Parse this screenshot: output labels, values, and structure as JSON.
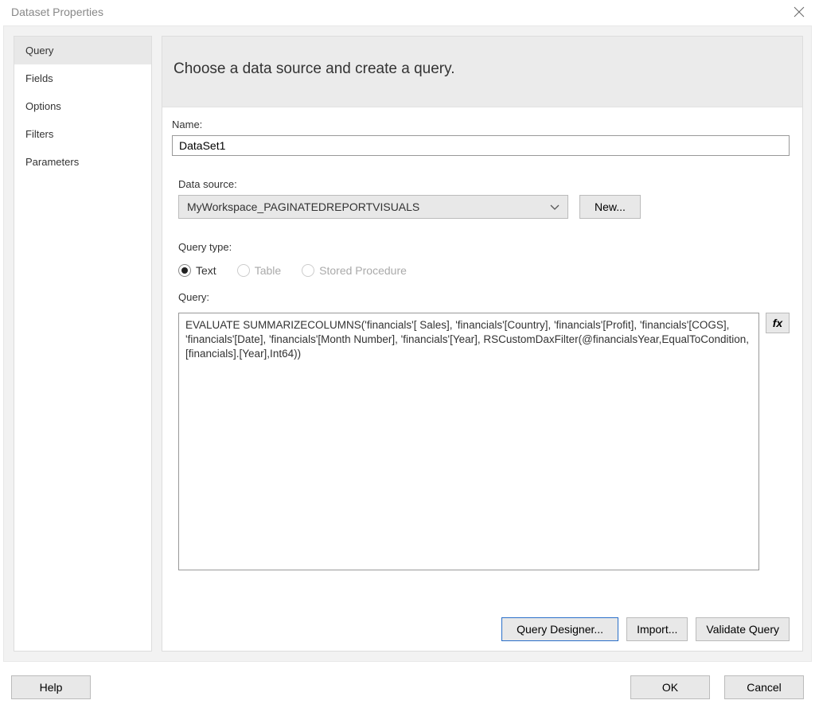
{
  "window": {
    "title": "Dataset Properties"
  },
  "sidebar": {
    "items": [
      {
        "label": "Query",
        "selected": true
      },
      {
        "label": "Fields",
        "selected": false
      },
      {
        "label": "Options",
        "selected": false
      },
      {
        "label": "Filters",
        "selected": false
      },
      {
        "label": "Parameters",
        "selected": false
      }
    ]
  },
  "main": {
    "heading": "Choose a data source and create a query.",
    "name_label": "Name:",
    "name_value": "DataSet1",
    "datasource_label": "Data source:",
    "datasource_value": "MyWorkspace_PAGINATEDREPORTVISUALS",
    "new_button": "New...",
    "querytype_label": "Query type:",
    "querytype_options": [
      {
        "label": "Text",
        "selected": true,
        "enabled": true
      },
      {
        "label": "Table",
        "selected": false,
        "enabled": false
      },
      {
        "label": "Stored Procedure",
        "selected": false,
        "enabled": false
      }
    ],
    "query_label": "Query:",
    "query_value": "EVALUATE SUMMARIZECOLUMNS('financials'[ Sales], 'financials'[Country], 'financials'[Profit], 'financials'[COGS], 'financials'[Date], 'financials'[Month Number], 'financials'[Year], RSCustomDaxFilter(@financialsYear,EqualToCondition,[financials].[Year],Int64))",
    "fx_label": "fx",
    "query_designer_button": "Query Designer...",
    "import_button": "Import...",
    "validate_button": "Validate Query"
  },
  "footer": {
    "help": "Help",
    "ok": "OK",
    "cancel": "Cancel"
  }
}
